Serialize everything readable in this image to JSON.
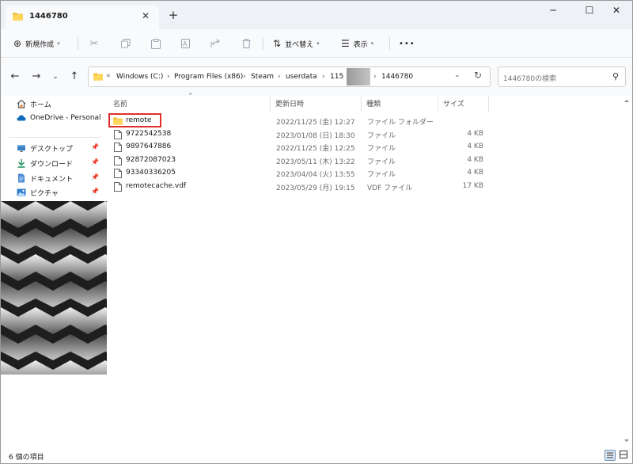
{
  "window": {
    "tab_title": "1446780",
    "tab_close": "✕",
    "new_tab": "+",
    "minimize": "─",
    "maximize": "☐",
    "close": "✕"
  },
  "commandbar": {
    "new_label": "新規作成",
    "sort_label": "並べ替え",
    "view_label": "表示",
    "more_label": "•••"
  },
  "address": {
    "breadcrumbs": [
      "Windows (C:)",
      "Program Files (x86)",
      "Steam",
      "userdata",
      "115",
      "1446780"
    ],
    "overflow": "«",
    "search_placeholder": "1446780の検索"
  },
  "sidebar": {
    "items": [
      {
        "label": "ホーム",
        "icon": "home-icon"
      },
      {
        "label": "OneDrive - Personal",
        "icon": "cloud-icon"
      },
      {
        "label": "デスクトップ",
        "icon": "desktop-icon"
      },
      {
        "label": "ダウンロード",
        "icon": "download-icon"
      },
      {
        "label": "ドキュメント",
        "icon": "document-icon"
      },
      {
        "label": "ピクチャ",
        "icon": "picture-icon"
      }
    ]
  },
  "columns": {
    "name": "名前",
    "date": "更新日時",
    "type": "種類",
    "size": "サイズ"
  },
  "files": [
    {
      "name": "remote",
      "date": "2022/11/25 (金) 12:27",
      "type": "ファイル フォルダー",
      "size": "",
      "kind": "folder"
    },
    {
      "name": "9722542538",
      "date": "2023/01/08 (日) 18:30",
      "type": "ファイル",
      "size": "4 KB",
      "kind": "file"
    },
    {
      "name": "9897647886",
      "date": "2022/11/25 (金) 12:25",
      "type": "ファイル",
      "size": "4 KB",
      "kind": "file"
    },
    {
      "name": "92872087023",
      "date": "2023/05/11 (木) 13:22",
      "type": "ファイル",
      "size": "4 KB",
      "kind": "file"
    },
    {
      "name": "93340336205",
      "date": "2023/04/04 (火) 13:55",
      "type": "ファイル",
      "size": "4 KB",
      "kind": "file"
    },
    {
      "name": "remotecache.vdf",
      "date": "2023/05/29 (月) 19:15",
      "type": "VDF ファイル",
      "size": "17 KB",
      "kind": "file"
    }
  ],
  "status": {
    "count_text": "6 個の項目"
  },
  "colors": {
    "folder": "#f4c542",
    "accent": "#0067c0",
    "highlight_box": "#e0302c"
  }
}
